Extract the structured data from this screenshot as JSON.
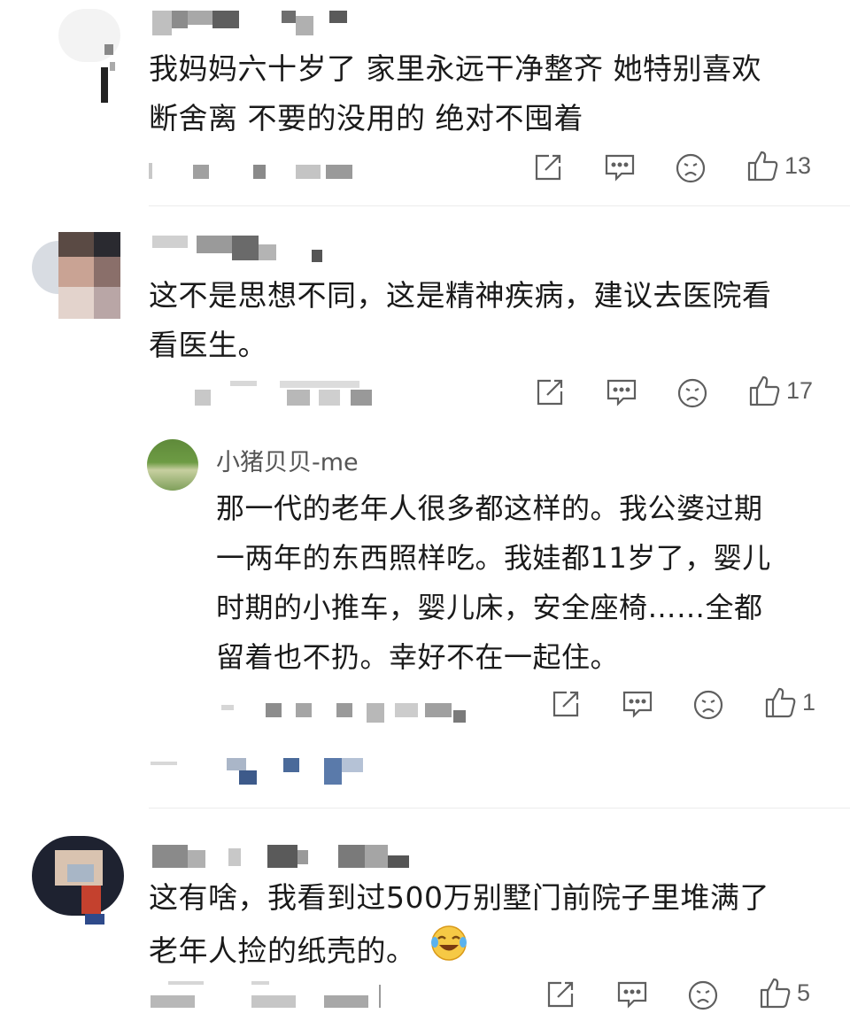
{
  "comments": [
    {
      "text_lines": [
        "我妈妈六十岁了 家里永远干净整齐 她特别喜欢",
        "断舍离 不要的没用的 绝对不囤着"
      ],
      "likes": "13"
    },
    {
      "text_lines": [
        "这不是思想不同，这是精神疾病，建议去医院看",
        "看医生。"
      ],
      "likes": "17",
      "reply": {
        "name": "小猪贝贝-me",
        "text_lines": [
          "那一代的老年人很多都这样的。我公婆过期",
          "一两年的东西照样吃。我娃都11岁了，婴儿",
          "时期的小推车，婴儿床，安全座椅……全都",
          "留着也不扔。幸好不在一起住。"
        ],
        "likes": "1"
      }
    },
    {
      "text_lines": [
        "这有啥，我看到过500万别墅门前院子里堆满了",
        "老年人捡的纸壳的。"
      ],
      "emoji": "laughing-crying-emoji",
      "likes": "5"
    }
  ],
  "icons": {
    "share": "share-icon",
    "reply": "comment-icon",
    "dislike": "sad-face-icon",
    "like": "thumbs-up-icon"
  },
  "colors": {
    "icon": "#5f5f5f",
    "text": "#1a1a1a",
    "censor_gray": "#9a9a9a",
    "censor_blue": "#3d5a8a"
  }
}
